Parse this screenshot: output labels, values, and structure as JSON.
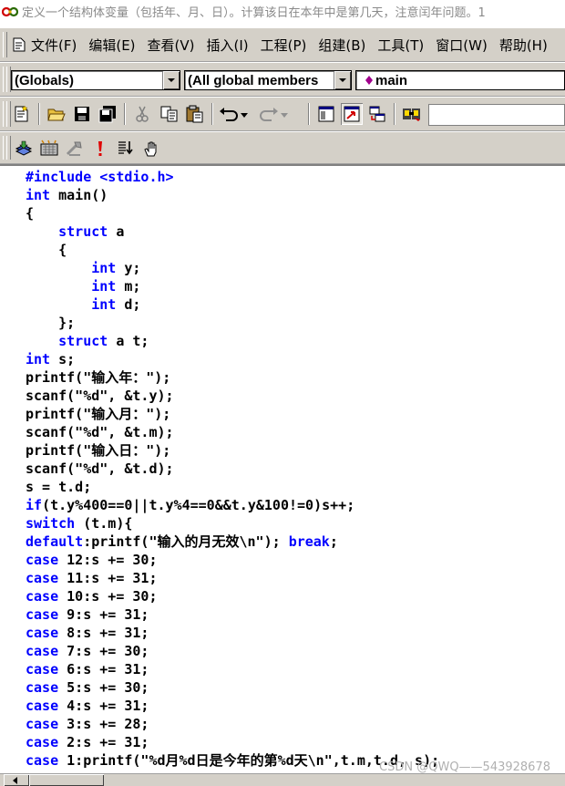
{
  "window": {
    "title": "定义一个结构体变量（包括年、月、日）。计算该日在本年中是第几天，注意闰年问题。1"
  },
  "menubar": {
    "items": [
      "文件(F)",
      "编辑(E)",
      "查看(V)",
      "插入(I)",
      "工程(P)",
      "组建(B)",
      "工具(T)",
      "窗口(W)",
      "帮助(H)"
    ]
  },
  "wizardbar": {
    "scope": "(Globals)",
    "members": "(All global members",
    "function": "main",
    "function_icon_color": "#a0008c"
  },
  "toolbar1": {
    "icons": [
      "workspace-icon",
      "open-icon",
      "save-icon",
      "save-all-icon",
      "cut-icon",
      "copy-icon",
      "paste-icon",
      "undo-icon",
      "redo-icon",
      "workspace-window-icon",
      "output-window-icon",
      "window-list-icon",
      "find-in-files-icon"
    ],
    "find_value": ""
  },
  "toolbar2": {
    "icons": [
      "compile-icon",
      "build-icon",
      "stop-build-icon",
      "execute-icon",
      "go-icon",
      "breakpoint-icon"
    ]
  },
  "editor": {
    "keyword_color": "#0000ff",
    "lines": [
      [
        {
          "t": "#include <stdio.h>",
          "k": true
        }
      ],
      [
        {
          "t": "int",
          "k": true
        },
        {
          "t": " main()"
        }
      ],
      [
        {
          "t": "{"
        }
      ],
      [
        {
          "t": "    "
        },
        {
          "t": "struct",
          "k": true
        },
        {
          "t": " a"
        }
      ],
      [
        {
          "t": "    {"
        }
      ],
      [
        {
          "t": "        "
        },
        {
          "t": "int",
          "k": true
        },
        {
          "t": " y;"
        }
      ],
      [
        {
          "t": "        "
        },
        {
          "t": "int",
          "k": true
        },
        {
          "t": " m;"
        }
      ],
      [
        {
          "t": "        "
        },
        {
          "t": "int",
          "k": true
        },
        {
          "t": " d;"
        }
      ],
      [
        {
          "t": "    };"
        }
      ],
      [
        {
          "t": "    "
        },
        {
          "t": "struct",
          "k": true
        },
        {
          "t": " a t;"
        }
      ],
      [
        {
          "t": "int",
          "k": true
        },
        {
          "t": " s;"
        }
      ],
      [
        {
          "t": "printf(\"输入年：\");"
        }
      ],
      [
        {
          "t": "scanf(\"%d\", &t.y);"
        }
      ],
      [
        {
          "t": "printf(\"输入月：\");"
        }
      ],
      [
        {
          "t": "scanf(\"%d\", &t.m);"
        }
      ],
      [
        {
          "t": "printf(\"输入日：\");"
        }
      ],
      [
        {
          "t": "scanf(\"%d\", &t.d);"
        }
      ],
      [
        {
          "t": "s = t.d;"
        }
      ],
      [
        {
          "t": "if",
          "k": true
        },
        {
          "t": "(t.y%400==0||t.y%4==0&&t.y&100!=0)s++;"
        }
      ],
      [
        {
          "t": "switch",
          "k": true
        },
        {
          "t": " (t.m){"
        }
      ],
      [
        {
          "t": "default",
          "k": true
        },
        {
          "t": ":printf(\"输入的月无效\\n\"); "
        },
        {
          "t": "break",
          "k": true
        },
        {
          "t": ";"
        }
      ],
      [
        {
          "t": "case",
          "k": true
        },
        {
          "t": " 12:s += 30;"
        }
      ],
      [
        {
          "t": "case",
          "k": true
        },
        {
          "t": " 11:s += 31;"
        }
      ],
      [
        {
          "t": "case",
          "k": true
        },
        {
          "t": " 10:s += 30;"
        }
      ],
      [
        {
          "t": "case",
          "k": true
        },
        {
          "t": " 9:s += 31;"
        }
      ],
      [
        {
          "t": "case",
          "k": true
        },
        {
          "t": " 8:s += 31;"
        }
      ],
      [
        {
          "t": "case",
          "k": true
        },
        {
          "t": " 7:s += 30;"
        }
      ],
      [
        {
          "t": "case",
          "k": true
        },
        {
          "t": " 6:s += 31;"
        }
      ],
      [
        {
          "t": "case",
          "k": true
        },
        {
          "t": " 5:s += 30;"
        }
      ],
      [
        {
          "t": "case",
          "k": true
        },
        {
          "t": " 4:s += 31;"
        }
      ],
      [
        {
          "t": "case",
          "k": true
        },
        {
          "t": " 3:s += 28;"
        }
      ],
      [
        {
          "t": "case",
          "k": true
        },
        {
          "t": " 2:s += 31;"
        }
      ],
      [
        {
          "t": "case",
          "k": true
        },
        {
          "t": " 1:printf(\"%d月%d日是今年的第%d天\\n\",t.m,t.d, s);"
        }
      ]
    ]
  },
  "watermark": "CSDN @QWQ——543928678"
}
